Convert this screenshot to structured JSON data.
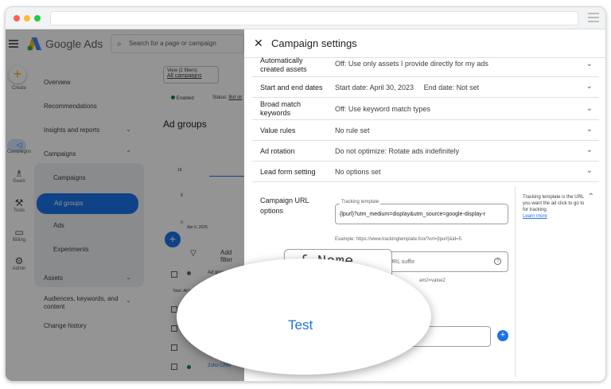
{
  "app": {
    "brand": "Google Ads",
    "search_placeholder": "Search for a page or campaign"
  },
  "rail": {
    "create": "+",
    "items": [
      {
        "label": "Create"
      },
      {
        "label": "Campaigns"
      },
      {
        "label": "Goals"
      },
      {
        "label": "Tools"
      },
      {
        "label": "Billing"
      },
      {
        "label": "Admin"
      }
    ]
  },
  "sidenav": {
    "overview": "Overview",
    "recommendations": "Recommendations",
    "insights": "Insights and reports",
    "campaigns": "Campaigns",
    "campaigns_sub": "Campaigns",
    "ad_groups": "Ad groups",
    "ads": "Ads",
    "experiments": "Experiments",
    "assets": "Assets",
    "audiences": "Audiences, keywords, and content",
    "change_history": "Change history"
  },
  "content": {
    "view_label": "View (2 filters)",
    "view_value": "All campaigns",
    "status_enabled": "Enabled",
    "status_label": "Status:",
    "status_value": "Bid str",
    "page_title": "Ad groups",
    "y_16": "16",
    "y_8": "8",
    "y_0": "0",
    "date": "Apr 6, 2025",
    "add_filter": "Add filter",
    "col_ad_group": "Ad grou",
    "total": "Total: All but",
    "row_name": "Zoho CRM"
  },
  "panel": {
    "title": "Campaign settings",
    "rows": [
      {
        "label": "Automatically created assets",
        "value": "Off: Use only assets I provide directly for my ads"
      },
      {
        "label": "Start and end dates",
        "value": "Start date: April 30, 2023     End date: Not set"
      },
      {
        "label": "Broad match keywords",
        "value": "Off: Use keyword match types"
      },
      {
        "label": "Value rules",
        "value": "No rule set"
      },
      {
        "label": "Ad rotation",
        "value": "Do not optimize: Rotate ads indefinitely"
      },
      {
        "label": "Lead form setting",
        "value": "No options set"
      }
    ],
    "url_options": {
      "label": "Campaign URL options",
      "tracking_label": "Tracking template",
      "tracking_value": "{lpurl}?utm_medium=display&utm_source=google-display-r",
      "example": "Example: https://www.trackingtemplate.foo/?url={lpurl}&id=5",
      "suffix_placeholder": "Final URL suffix",
      "suffix_example": "am2=value2",
      "help_text": "Tracking template is the URL you want the ad click to go to for tracking.",
      "help_link": "Learn more"
    }
  },
  "zoom": {
    "chip_text": "{_Name",
    "test_label": "Test"
  },
  "colors": {
    "accent": "#1a73e8",
    "overlay": "#000000"
  }
}
